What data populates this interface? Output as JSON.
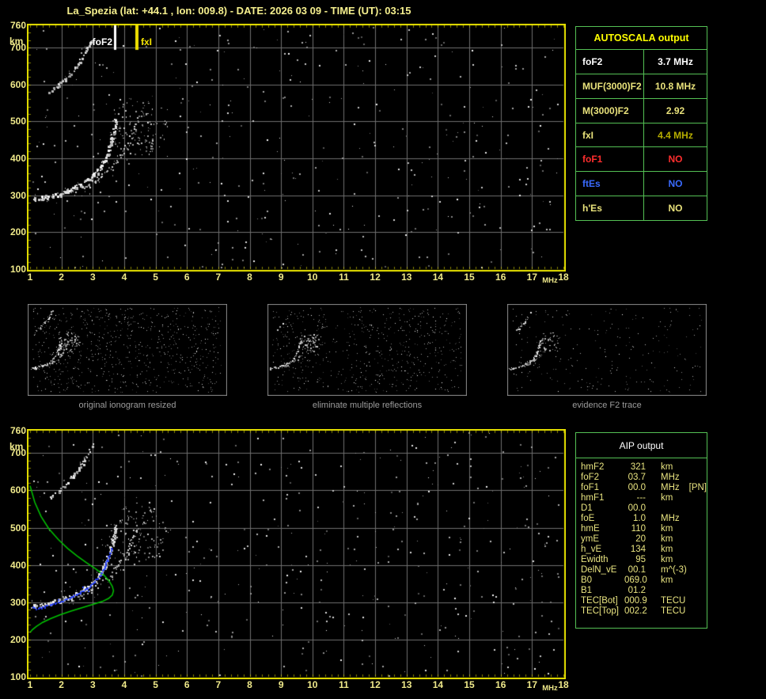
{
  "title": "La_Spezia (lat: +44.1 , lon: 009.8) - DATE: 2026 03 09 - TIME (UT): 03:15",
  "plots": {
    "x_ticks": [
      "1",
      "2",
      "3",
      "4",
      "5",
      "6",
      "7",
      "8",
      "9",
      "10",
      "11",
      "12",
      "13",
      "14",
      "15",
      "16",
      "17",
      "18"
    ],
    "x_unit": "MHz",
    "y_ticks": [
      "760",
      "700",
      "600",
      "500",
      "400",
      "300",
      "200",
      "100"
    ],
    "y_tick_values_km": [
      760,
      700,
      600,
      500,
      400,
      300,
      200,
      100
    ],
    "y_unit": "km",
    "x_range_mhz": [
      1,
      18
    ],
    "y_range_km": [
      100,
      760
    ],
    "markers": {
      "foF2": {
        "label": "foF2",
        "freq_mhz": 3.7,
        "color": "#ffffff"
      },
      "fxI": {
        "label": "fxI",
        "freq_mhz": 4.4,
        "color": "#f0e000"
      }
    }
  },
  "traces": {
    "f2_ordinary": [
      [
        1.05,
        291
      ],
      [
        1.3,
        294
      ],
      [
        1.6,
        299
      ],
      [
        1.95,
        306
      ],
      [
        2.3,
        317
      ],
      [
        2.6,
        329
      ],
      [
        2.85,
        343
      ],
      [
        3.05,
        358
      ],
      [
        3.2,
        374
      ],
      [
        3.35,
        394
      ],
      [
        3.47,
        418
      ],
      [
        3.57,
        444
      ],
      [
        3.65,
        470
      ],
      [
        3.7,
        492
      ],
      [
        3.73,
        508
      ]
    ],
    "f2_extraordinary": [
      [
        2.25,
        309
      ],
      [
        2.55,
        318
      ],
      [
        2.85,
        330
      ],
      [
        3.1,
        343
      ],
      [
        3.35,
        358
      ],
      [
        3.6,
        377
      ],
      [
        3.8,
        398
      ],
      [
        4.0,
        422
      ],
      [
        4.15,
        447
      ],
      [
        4.28,
        472
      ],
      [
        4.38,
        497
      ],
      [
        4.45,
        515
      ]
    ],
    "second_reflection": [
      [
        1.58,
        577
      ],
      [
        1.75,
        589
      ],
      [
        1.95,
        603
      ],
      [
        2.15,
        620
      ],
      [
        2.35,
        639
      ],
      [
        2.55,
        661
      ],
      [
        2.72,
        684
      ],
      [
        2.87,
        708
      ],
      [
        2.98,
        728
      ]
    ],
    "spread_cluster": {
      "center_mhz": 4.45,
      "center_km": 487,
      "rx_mhz": 0.95,
      "ry_km": 80
    },
    "profile_green": [
      [
        1.0,
        612
      ],
      [
        1.15,
        568
      ],
      [
        1.35,
        530
      ],
      [
        1.6,
        497
      ],
      [
        1.9,
        468
      ],
      [
        2.2,
        444
      ],
      [
        2.5,
        424
      ],
      [
        2.8,
        406
      ],
      [
        3.1,
        389
      ],
      [
        3.35,
        373
      ],
      [
        3.52,
        357
      ],
      [
        3.62,
        343
      ],
      [
        3.66,
        331
      ],
      [
        3.62,
        319
      ],
      [
        3.5,
        310
      ],
      [
        3.3,
        302
      ],
      [
        3.0,
        294
      ],
      [
        2.65,
        285
      ],
      [
        2.3,
        276
      ],
      [
        1.95,
        266
      ],
      [
        1.65,
        256
      ],
      [
        1.4,
        246
      ],
      [
        1.2,
        235
      ],
      [
        1.07,
        226
      ],
      [
        1.0,
        219
      ]
    ],
    "fitted_trace_blue": [
      [
        1.05,
        290
      ],
      [
        1.18,
        285
      ],
      [
        1.35,
        287
      ],
      [
        1.6,
        293
      ],
      [
        1.95,
        303
      ],
      [
        2.25,
        313
      ],
      [
        2.55,
        325
      ],
      [
        2.8,
        338
      ],
      [
        3.0,
        352
      ],
      [
        3.18,
        369
      ],
      [
        3.32,
        388
      ],
      [
        3.44,
        410
      ],
      [
        3.53,
        432
      ],
      [
        3.6,
        450
      ]
    ]
  },
  "autoscala_table": {
    "header": "AUTOSCALA output",
    "rows": [
      {
        "name": "foF2",
        "value": "3.7 MHz",
        "color": "#ffffff"
      },
      {
        "name": "MUF(3000)F2",
        "value": "10.8 MHz",
        "color": "#e9e27b"
      },
      {
        "name": "M(3000)F2",
        "value": "2.92",
        "color": "#e9e27b"
      },
      {
        "name": "fxI",
        "value": "4.4 MHz",
        "color": "#e9e27b",
        "value_color": "#b7ae00"
      },
      {
        "name": "foF1",
        "value": "NO",
        "color": "#ff2e2e"
      },
      {
        "name": "ftEs",
        "value": "NO",
        "color": "#3a6bff"
      },
      {
        "name": "h'Es",
        "value": "NO",
        "color": "#e9e27b"
      }
    ]
  },
  "thumbnails": [
    {
      "caption": "original ionogram resized"
    },
    {
      "caption": "eliminate multiple reflections"
    },
    {
      "caption": "evidence F2 trace"
    }
  ],
  "aip_table": {
    "header": "AIP output",
    "rows": [
      {
        "name": "hmF2",
        "value": "321",
        "unit": "km",
        "extra": ""
      },
      {
        "name": "foF2",
        "value": "03.7",
        "unit": "MHz",
        "extra": ""
      },
      {
        "name": "foF1",
        "value": "00.0",
        "unit": "MHz",
        "extra": "[PN]"
      },
      {
        "name": "hmF1",
        "value": "---",
        "unit": "km",
        "extra": ""
      },
      {
        "name": "D1",
        "value": "00.0",
        "unit": "",
        "extra": ""
      },
      {
        "name": "foE",
        "value": "1.0",
        "unit": "MHz",
        "extra": ""
      },
      {
        "name": "hmE",
        "value": "110",
        "unit": "km",
        "extra": ""
      },
      {
        "name": "ymE",
        "value": "20",
        "unit": "km",
        "extra": ""
      },
      {
        "name": "h_vE",
        "value": "134",
        "unit": "km",
        "extra": ""
      },
      {
        "name": "Ewidth",
        "value": "95",
        "unit": "km",
        "extra": ""
      },
      {
        "name": "DelN_vE",
        "value": "00.1",
        "unit": "m^(-3)",
        "extra": ""
      },
      {
        "name": "B0",
        "value": "069.0",
        "unit": "km",
        "extra": ""
      },
      {
        "name": "B1",
        "value": "01.2",
        "unit": "",
        "extra": ""
      },
      {
        "name": "TEC[Bot]",
        "value": "000.9",
        "unit": "TECU",
        "extra": ""
      },
      {
        "name": "TEC[Top]",
        "value": "002.2",
        "unit": "TECU",
        "extra": ""
      }
    ]
  },
  "colors": {
    "title": "#f6f08e",
    "axis_label": "#efe98a",
    "plot_border": "#e8e200",
    "grid": "#6f6f6f",
    "table_border": "#54c054",
    "autoscala_header": "#ffff00",
    "aip_text": "#e9e480",
    "aip_header": "#ffffff",
    "caption": "#9c9c9c",
    "thumb_border": "#8d8d8d",
    "profile_green": "#00c400",
    "fit_blue": "#2b3cf0"
  }
}
